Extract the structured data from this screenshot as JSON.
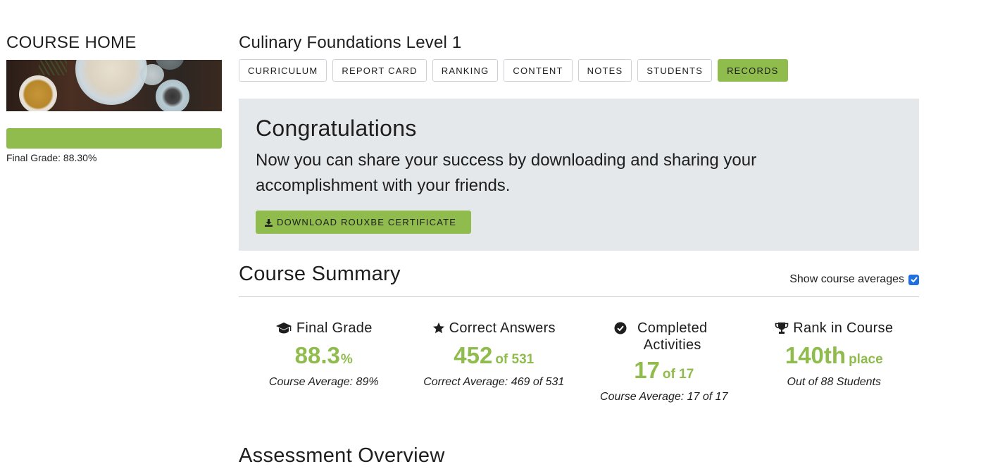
{
  "sidebar": {
    "heading": "COURSE HOME",
    "progress_fraction": 1.0,
    "final_grade_text": "Final Grade: 88.30%"
  },
  "header": {
    "course_title": "Culinary Foundations Level 1",
    "tabs": [
      {
        "label": "CURRICULUM",
        "active": false
      },
      {
        "label": "REPORT CARD",
        "active": false
      },
      {
        "label": "RANKING",
        "active": false
      },
      {
        "label": "CONTENT",
        "active": false
      },
      {
        "label": "NOTES",
        "active": false
      },
      {
        "label": "STUDENTS",
        "active": false
      },
      {
        "label": "RECORDS",
        "active": true
      }
    ]
  },
  "congrats": {
    "title": "Congratulations",
    "message": "Now you can share your success by downloading and sharing your accomplishment with your friends.",
    "download_label": "DOWNLOAD ROUXBE CERTIFICATE",
    "download_icon": "download-icon"
  },
  "summary": {
    "title": "Course Summary",
    "show_averages_label": "Show course averages",
    "show_averages_checked": true,
    "stats": [
      {
        "icon": "graduation-cap-icon",
        "label": "Final Grade",
        "value": "88.3",
        "suffix": "%",
        "sub": "Course Average: 89%"
      },
      {
        "icon": "star-icon",
        "label": "Correct Answers",
        "value": "452",
        "suffix": "of 531",
        "sub": "Correct Average: 469 of 531"
      },
      {
        "icon": "check-circle-icon",
        "label": "Completed Activities",
        "value": "17",
        "suffix": "of 17",
        "sub": "Course Average: 17 of 17"
      },
      {
        "icon": "trophy-icon",
        "label": "Rank in Course",
        "value": "140th",
        "suffix": "place",
        "sub": "Out of 88 Students"
      }
    ]
  },
  "assessment": {
    "title": "Assessment Overview"
  },
  "colors": {
    "accent_green": "#8fbc4c",
    "panel_gray": "#e5e8eb",
    "checkbox_blue": "#1f6fe0"
  }
}
